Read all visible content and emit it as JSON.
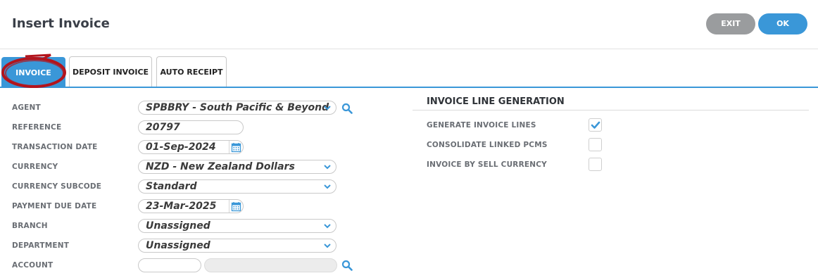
{
  "header": {
    "title": "Insert Invoice",
    "exit_label": "EXIT",
    "ok_label": "OK"
  },
  "tabs": [
    {
      "label": "INVOICE",
      "active": true
    },
    {
      "label": "DEPOSIT INVOICE",
      "active": false
    },
    {
      "label": "AUTO RECEIPT",
      "active": false
    }
  ],
  "form": {
    "agent": {
      "label": "AGENT",
      "value": "SPBBRY - South Pacific & Beyond"
    },
    "reference": {
      "label": "REFERENCE",
      "value": "20797"
    },
    "transaction_date": {
      "label": "TRANSACTION DATE",
      "value": "01-Sep-2024"
    },
    "currency": {
      "label": "CURRENCY",
      "value": "NZD - New Zealand Dollars"
    },
    "currency_subcode": {
      "label": "CURRENCY SUBCODE",
      "value": "Standard"
    },
    "payment_due_date": {
      "label": "PAYMENT DUE DATE",
      "value": "23-Mar-2025"
    },
    "branch": {
      "label": "BRANCH",
      "value": "Unassigned"
    },
    "department": {
      "label": "DEPARTMENT",
      "value": "Unassigned"
    },
    "account": {
      "label": "ACCOUNT",
      "code": "",
      "name": ""
    }
  },
  "line_generation": {
    "title": "INVOICE LINE GENERATION",
    "options": [
      {
        "label": "GENERATE INVOICE LINES",
        "checked": true
      },
      {
        "label": "CONSOLIDATE LINKED PCMS",
        "checked": false
      },
      {
        "label": "INVOICE BY SELL CURRENCY",
        "checked": false
      }
    ]
  },
  "colors": {
    "accent": "#3a97d8",
    "exit": "#9a9c9e",
    "annotation": "#b3141c"
  },
  "icons": [
    "search-icon",
    "calendar-icon",
    "chevron-down-icon",
    "check-icon"
  ]
}
